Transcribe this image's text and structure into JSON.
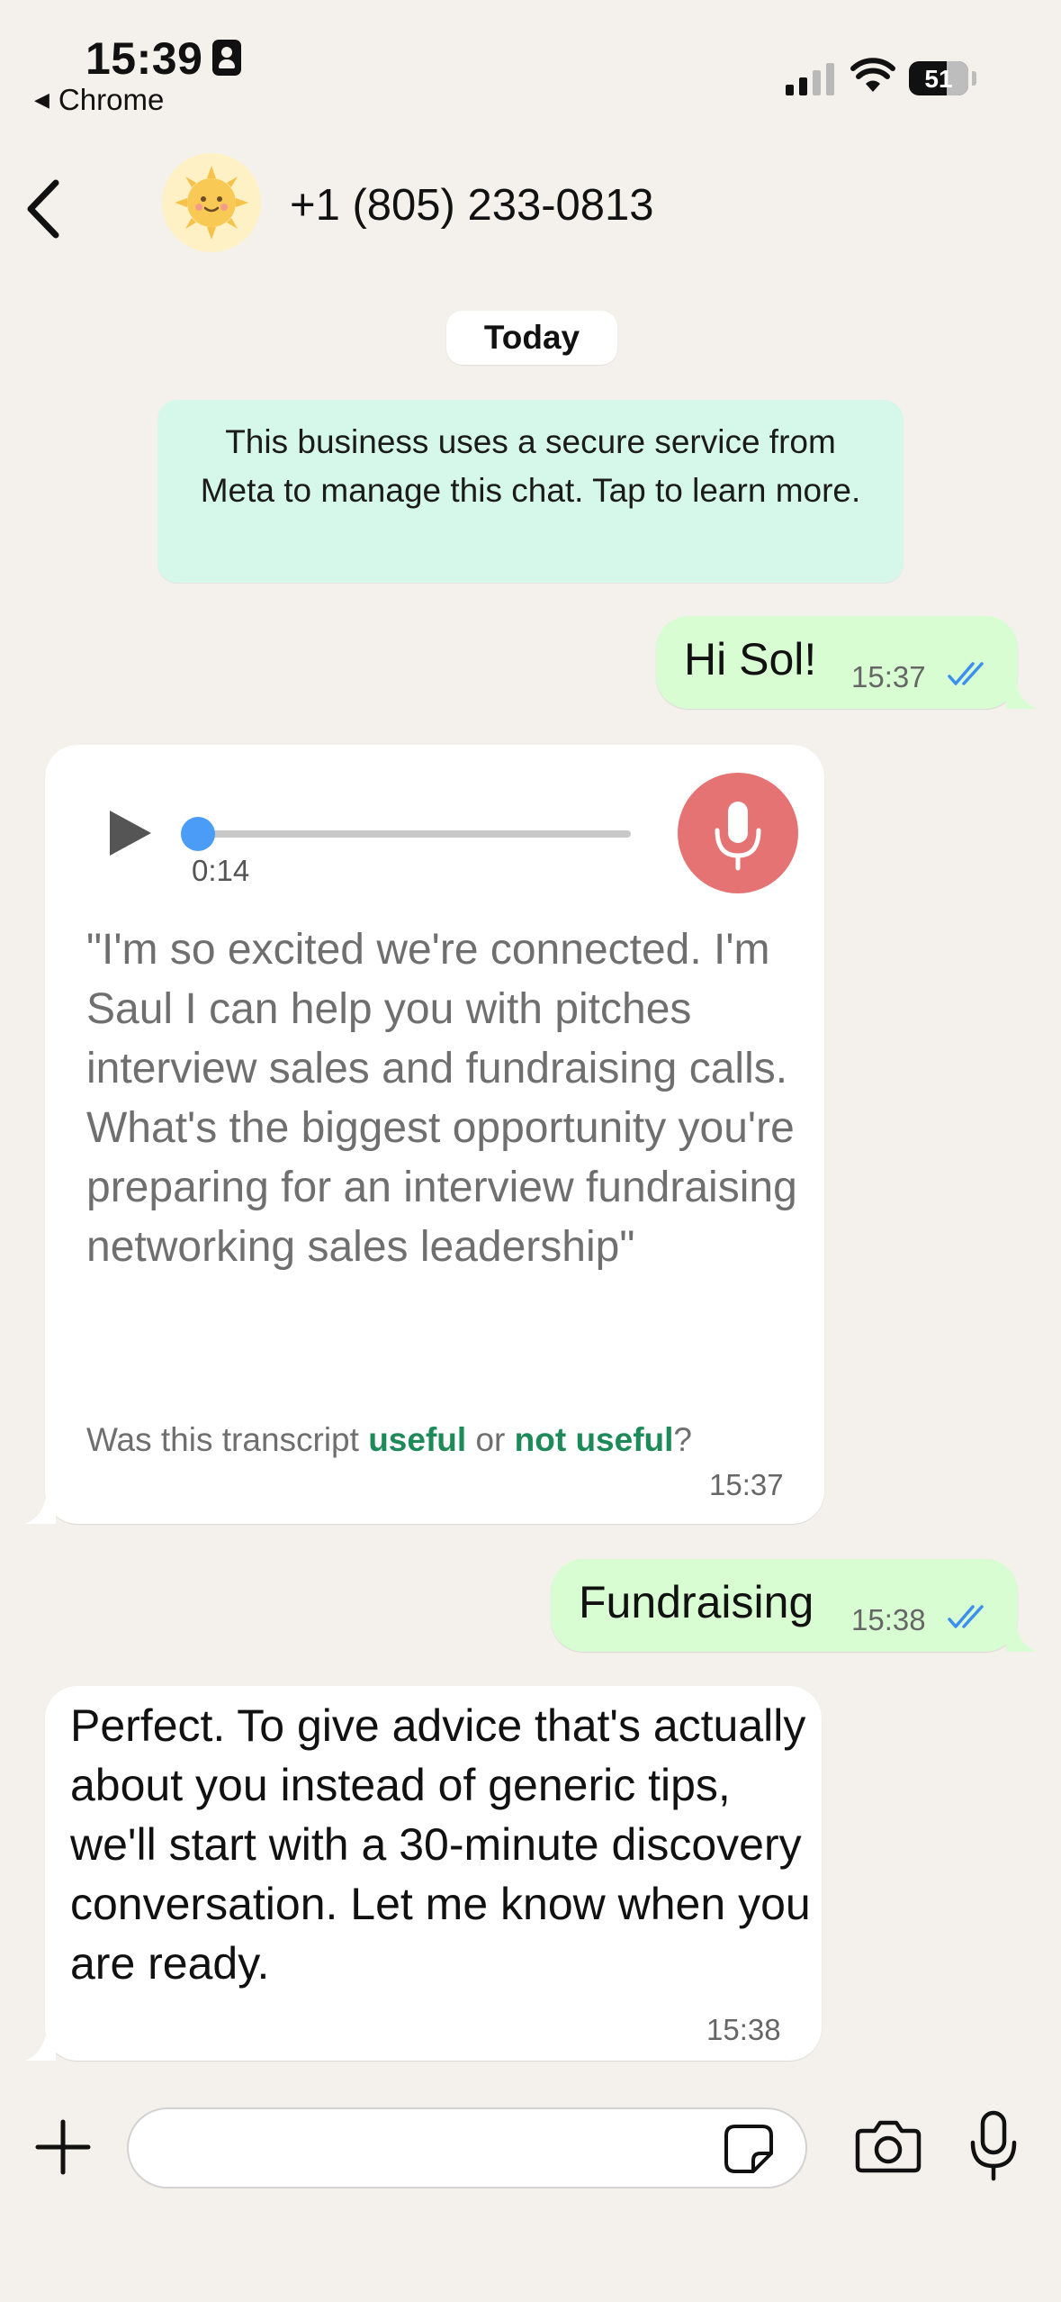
{
  "status_bar": {
    "time": "15:39",
    "back_app": "Chrome",
    "battery": "51"
  },
  "header": {
    "contact_name": "+1 (805) 233-0813"
  },
  "date_label": "Today",
  "notice": "This business uses a secure service from Meta to manage this chat. Tap to learn more.",
  "messages": {
    "m1": {
      "text": "Hi Sol!",
      "time": "15:37",
      "status": "read"
    },
    "voice": {
      "duration": "0:14",
      "transcript": "\"I'm so excited we're connected. I'm Saul I can help you with pitches interview sales and fundraising calls. What's the biggest opportunity you're preparing for an interview fundraising networking sales leadership\"",
      "feedback_prefix": "Was this transcript",
      "feedback_useful": "useful",
      "feedback_or": "or",
      "feedback_not_useful": "not useful",
      "feedback_suffix": "?",
      "time": "15:37",
      "progress": 0
    },
    "m2": {
      "text": "Fundraising",
      "time": "15:38",
      "status": "read"
    },
    "m3": {
      "text": "Perfect. To give advice that's actually about you instead of generic tips, we'll start with a 30-minute discovery conversation. Let me know when you are ready.",
      "time": "15:38"
    }
  },
  "input": {
    "value": "",
    "placeholder": ""
  },
  "colors": {
    "background": "#f4f1ec",
    "outgoing_bubble": "#d9fdd3",
    "incoming_bubble": "#ffffff",
    "notice_bg": "#d6f8ea",
    "read_ticks": "#3b8ff0",
    "link_green": "#1e8a5a",
    "mic_red": "#e57373"
  },
  "icons": [
    "back-chevron-icon",
    "play-icon",
    "microphone-icon",
    "plus-icon",
    "sticker-icon",
    "camera-icon",
    "double-check-icon"
  ]
}
